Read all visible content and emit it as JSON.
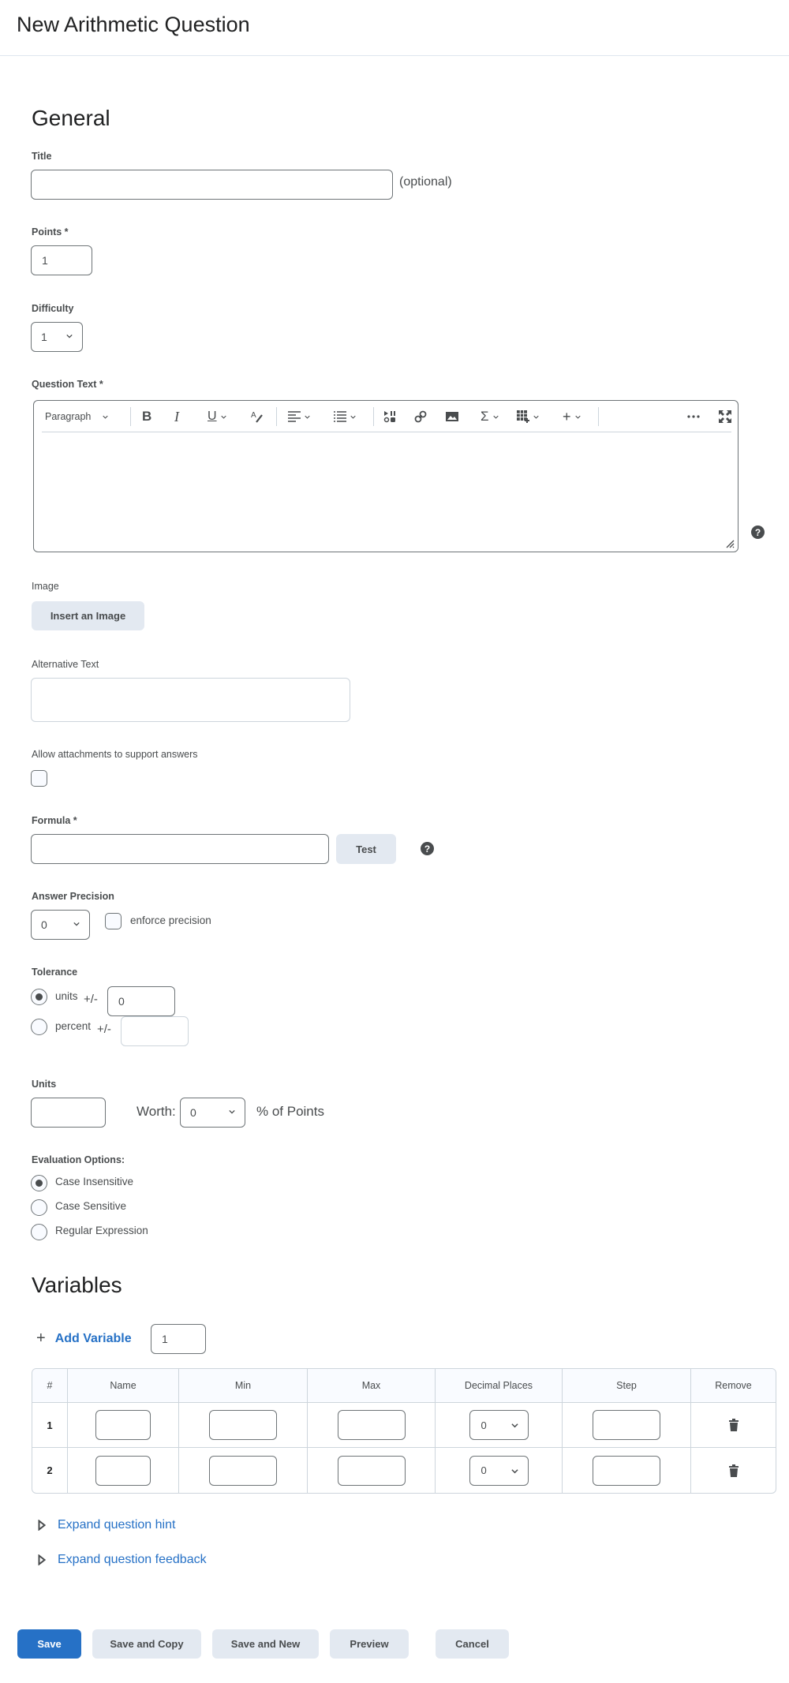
{
  "header": {
    "title": "New Arithmetic Question"
  },
  "general": {
    "section_title": "General",
    "title_label": "Title",
    "title_value": "",
    "title_optional": "(optional)",
    "points_label": "Points *",
    "points_value": "1",
    "difficulty_label": "Difficulty",
    "difficulty_value": "1",
    "question_text_label": "Question Text *",
    "editor": {
      "format_select": "Paragraph",
      "tools": [
        "bold",
        "italic",
        "underline",
        "strikethrough-format",
        "align",
        "list",
        "media-player",
        "link",
        "image",
        "equation",
        "table",
        "insert",
        "more",
        "fullscreen"
      ],
      "content": ""
    },
    "image_label": "Image",
    "insert_image_button": "Insert an Image",
    "alt_text_label": "Alternative Text",
    "alt_text_value": "",
    "allow_attachments_label": "Allow attachments to support answers",
    "allow_attachments_checked": false,
    "formula_label": "Formula *",
    "formula_value": "",
    "test_button": "Test",
    "answer_precision_label": "Answer Precision",
    "answer_precision_value": "0",
    "enforce_precision_label": "enforce precision",
    "enforce_precision_checked": false,
    "tolerance_label": "Tolerance",
    "tolerance_options": [
      {
        "label": "units",
        "suffix": "+/-",
        "value": "0",
        "checked": true
      },
      {
        "label": "percent",
        "suffix": "+/-",
        "value": "",
        "checked": false
      }
    ],
    "units_label": "Units",
    "units_value": "",
    "worth_label": "Worth:",
    "worth_value": "0",
    "worth_suffix": "% of Points",
    "evaluation_label": "Evaluation Options:",
    "evaluation_options": [
      {
        "label": "Case Insensitive",
        "checked": true
      },
      {
        "label": "Case Sensitive",
        "checked": false
      },
      {
        "label": "Regular Expression",
        "checked": false
      }
    ]
  },
  "variables": {
    "section_title": "Variables",
    "add_variable_label": "Add Variable",
    "add_variable_count": "1",
    "columns": [
      "#",
      "Name",
      "Min",
      "Max",
      "Decimal Places",
      "Step",
      "Remove"
    ],
    "rows": [
      {
        "index": "1",
        "name": "",
        "min": "",
        "max": "",
        "decimal_places": "0",
        "step": ""
      },
      {
        "index": "2",
        "name": "",
        "min": "",
        "max": "",
        "decimal_places": "0",
        "step": ""
      }
    ]
  },
  "expanders": {
    "hint": "Expand question hint",
    "feedback": "Expand question feedback"
  },
  "footer": {
    "save": "Save",
    "save_and_copy": "Save and Copy",
    "save_and_new": "Save and New",
    "preview": "Preview",
    "cancel": "Cancel"
  },
  "colors": {
    "primary": "#2671c6",
    "secondary_button": "#e3e9f1",
    "text": "#494c4e",
    "border": "#6e7477"
  }
}
